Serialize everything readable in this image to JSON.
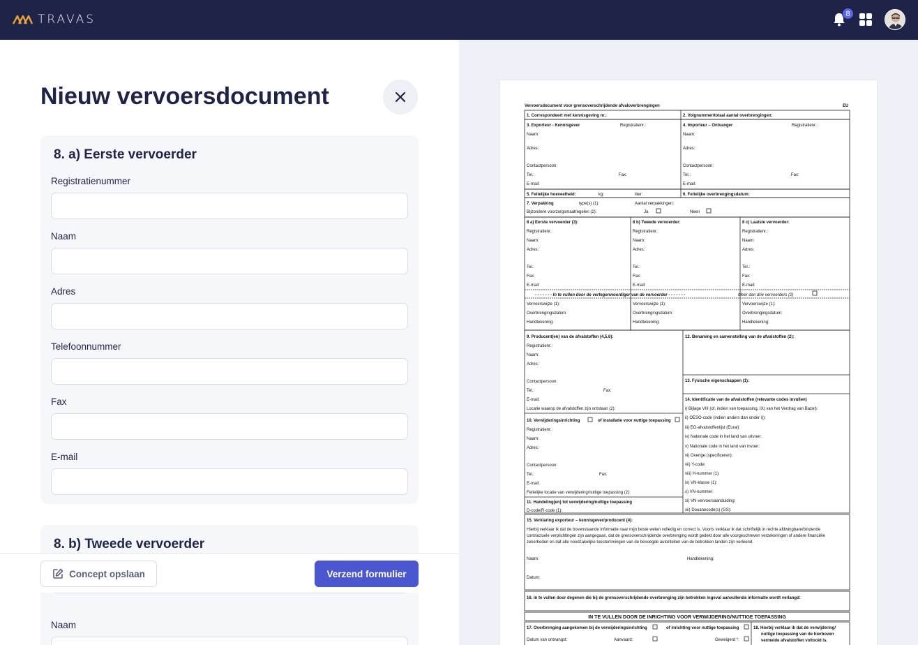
{
  "app": {
    "logo_text": "TRAVAS",
    "notification_count": "8"
  },
  "page": {
    "title": "Nieuw vervoersdocument"
  },
  "section_a": {
    "title": "8. a) Eerste vervoerder",
    "fields": [
      {
        "label": "Registratienummer",
        "value": "",
        "placeholder": ""
      },
      {
        "label": "Naam",
        "value": "",
        "placeholder": ""
      },
      {
        "label": "Adres",
        "value": "",
        "placeholder": ""
      },
      {
        "label": "Telefoonnummer",
        "value": "",
        "placeholder": ""
      },
      {
        "label": "Fax",
        "value": "",
        "placeholder": ""
      },
      {
        "label": "E-mail",
        "value": "",
        "placeholder": ""
      }
    ]
  },
  "section_b": {
    "title": "8. b) Tweede vervoerder",
    "fields": [
      {
        "label": "Naam"
      }
    ]
  },
  "actions": {
    "concept_label": "Concept opslaan",
    "send_label": "Verzend formulier"
  },
  "doc": {
    "header": "Vervoersdocument voor grensoverschrijdende afvaloverbrengingen",
    "eu": "EU",
    "r1_left": "1.   Correspondeert met kennisgeving nr.:",
    "r1_right": "2.   Volgnummer/totaal aantal overbrengingen:",
    "exporter": "3.   Exporteur - Kennisgever",
    "importer": "4.   Importeur – Ontvanger",
    "registratienr": "Registratienr.:",
    "naam": "Naam:",
    "adres": "Adres:",
    "contactpersoon": "Contactpersoon:",
    "tel": "Tel.:",
    "fax": "Fax:",
    "email": "E-mail:",
    "r5": "5.   Feitelijke hoeveelheid:",
    "kg": "kg:",
    "liter": "liter:",
    "r6": "6.   Feitelijke overbrengingsdatum:",
    "r7": "7.   Verpakking",
    "types": "type(s) (1):",
    "aantal": "Aantal verpakkingen:",
    "bijzondere": "Bijzondere voorzorgsmaatregelen (2):",
    "ja": "Ja",
    "neen": "Neen",
    "c8a": "8 a) Eerste vervoerder (3):",
    "c8b": "8 b) Tweede vervoerder:",
    "c8c": "8 c) Laatste vervoerder:",
    "in_te_vullen": "- - - - - - - In te vullen door de vertegenwoordiger van de vervoerder - - - - - - -",
    "meer": "Meer dan drie vervoerders (2)",
    "vervoerswijze": "Vervoerswijze (1):",
    "overbrengingsdatum": "Overbrengingsdatum:",
    "handtekening": "Handtekening:",
    "r9": "9.   Producent(en) van de afvalstoffen (4,5,6):",
    "locatie": "Locatie waarop de afvalstoffen zijn ontstaan (2):",
    "r12": "12.  Benaming en samenstelling van de afvalstoffen (2):",
    "r13": "13.  Fysische eigenschappen (1):",
    "r14": "14.  Identificatie van de afvalstoffen (relevante codes invullen)",
    "r14_items": [
      "i)    Bijlage VIII (of, indien van toepassing, IX) van het Verdrag van Bazel):",
      "ii)   OESO-code (indien anders dan onder i)):",
      "iii)  EG-afvalstoffenlijst (Eural):",
      "iv)  Nationale code in het land van uitvoer:",
      "v)   Nationale code in het land van invoer:",
      "vi)  Overige (specificeren):",
      "vii)  Y-code:",
      "viii)  H-nummer (1):",
      "ix)  VN-klasse (1):",
      "x)   VN-nummer:",
      "xi)  VN-vervoersaanduiding:",
      "xii)  Douanecode(s) (GS):"
    ],
    "r10": "10.  Verwijderingsinrichting",
    "r10_b": "of installatie voor nuttige toepassing",
    "feitelijke_locatie": "Feitelijke locatie van verwijdering/nuttige toepassing (2):",
    "r11": "11.  Handeling(en) tot verwijdering/nuttige toepassing",
    "dcode": "D-code/R-code (1):",
    "r15": "15.  Verklaring exporteur – kennisgever/producent (4):",
    "r15_text": [
      "Hierbij verklaar ik dat de bovenstaande informatie naar mijn beste weten volledig en correct is. Voorts verklaar ik dat schriftelijk in rechte afdwingbare/bindende",
      "contractuele verplichtingen zijn aangegaan, dat de grensoverschrijdende overbrenging wordt gedekt door alle voorgeschreven verzekeringen of andere financiële",
      "zekerheden en dat alle noodzakelijke toestemmingen van de bevoegde autoriteiten van de betrokken landen zijn verleend."
    ],
    "naam2": "Naam:",
    "handtekening2": "Handtekening:",
    "datum": "Datum:",
    "r16": "16.  In te vullen door degenen die bij de grensoverschrijdende overbrenging zijn betrokken ingeval aanvullende informatie wordt verlangd:",
    "inrichting_header": "IN TE VULLEN DOOR DE INRICHTING VOOR VERWIJDERING/NUTTIGE TOEPASSING",
    "r17": "17.  Overbrenging aangekomen bij de verwijderingsinrichting",
    "r17_b": "of inrichting voor nuttige toepassing",
    "datum_ontvangst": "Datum van ontvangst:",
    "aanvaard": "Aanvaard:",
    "geweigerd": "Geweigerd *:",
    "r18": [
      "18.  Hierbij verklaar ik dat de verwijdering/",
      "nuttige toepassing van de hierboven",
      "vermelde afvalstoffen voltooid is."
    ]
  }
}
